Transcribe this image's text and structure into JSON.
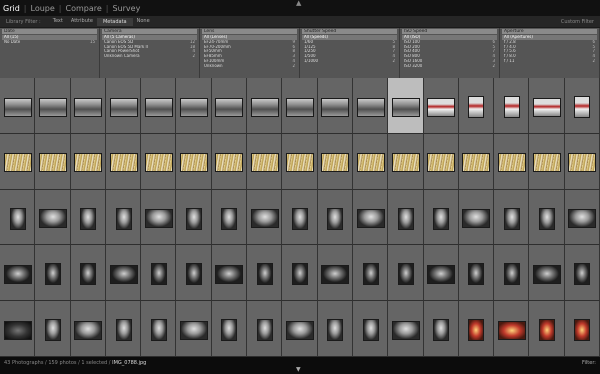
{
  "topbar": {
    "modes": [
      {
        "label": "Grid",
        "active": true
      },
      {
        "label": "Loupe",
        "active": false
      },
      {
        "label": "Compare",
        "active": false
      },
      {
        "label": "Survey",
        "active": false
      }
    ]
  },
  "library_filter": {
    "label": "Library Filter :",
    "items": [
      {
        "label": "Text",
        "active": false
      },
      {
        "label": "Attribute",
        "active": false
      },
      {
        "label": "Metadata",
        "active": true
      },
      {
        "label": "None",
        "active": false
      }
    ],
    "custom": "Custom Filter"
  },
  "filter_columns": [
    {
      "header": "Date",
      "rows": [
        {
          "label": "All (15)",
          "count": "",
          "sel": true
        },
        {
          "label": "No Date",
          "count": "15",
          "sel": false
        }
      ]
    },
    {
      "header": "Camera",
      "rows": [
        {
          "label": "All (5 Cameras)",
          "count": "",
          "sel": true
        },
        {
          "label": "Canon EOS 5D",
          "count": "12",
          "sel": false
        },
        {
          "label": "Canon EOS 5D Mark II",
          "count": "18",
          "sel": false
        },
        {
          "label": "Canon PowerShot",
          "count": "4",
          "sel": false
        },
        {
          "label": "Unknown Camera",
          "count": "2",
          "sel": false
        }
      ]
    },
    {
      "header": "Lens",
      "rows": [
        {
          "label": "All (Lenses)",
          "count": "",
          "sel": true
        },
        {
          "label": "EF24-70mm",
          "count": "9",
          "sel": false
        },
        {
          "label": "EF70-200mm",
          "count": "6",
          "sel": false
        },
        {
          "label": "EF50mm",
          "count": "8",
          "sel": false
        },
        {
          "label": "EF85mm",
          "count": "3",
          "sel": false
        },
        {
          "label": "EF100mm",
          "count": "4",
          "sel": false
        },
        {
          "label": "Unknown",
          "count": "2",
          "sel": false
        }
      ]
    },
    {
      "header": "Shutter Speed",
      "rows": [
        {
          "label": "All (Speeds)",
          "count": "",
          "sel": true
        },
        {
          "label": "1/60",
          "count": "5",
          "sel": false
        },
        {
          "label": "1/125",
          "count": "8",
          "sel": false
        },
        {
          "label": "1/250",
          "count": "7",
          "sel": false
        },
        {
          "label": "1/500",
          "count": "4",
          "sel": false
        },
        {
          "label": "1/1000",
          "count": "2",
          "sel": false
        }
      ]
    },
    {
      "header": "ISO Speed",
      "rows": [
        {
          "label": "All (ISO)",
          "count": "",
          "sel": true
        },
        {
          "label": "ISO 100",
          "count": "6",
          "sel": false
        },
        {
          "label": "ISO 200",
          "count": "5",
          "sel": false
        },
        {
          "label": "ISO 400",
          "count": "7",
          "sel": false
        },
        {
          "label": "ISO 800",
          "count": "4",
          "sel": false
        },
        {
          "label": "ISO 1600",
          "count": "3",
          "sel": false
        },
        {
          "label": "ISO 3200",
          "count": "2",
          "sel": false
        }
      ]
    },
    {
      "header": "Aperture",
      "rows": [
        {
          "label": "All (Apertures)",
          "count": "",
          "sel": true
        },
        {
          "label": "f / 2.8",
          "count": "6",
          "sel": false
        },
        {
          "label": "f / 4.0",
          "count": "5",
          "sel": false
        },
        {
          "label": "f / 5.6",
          "count": "7",
          "sel": false
        },
        {
          "label": "f / 8.0",
          "count": "4",
          "sel": false
        },
        {
          "label": "f / 11",
          "count": "2",
          "sel": false
        }
      ]
    }
  ],
  "grid": {
    "rows": [
      {
        "cells": [
          "office",
          "office",
          "office",
          "office",
          "office",
          "office",
          "office",
          "office",
          "office",
          "office",
          "office",
          "office",
          "people",
          "people",
          "people",
          "people",
          "people"
        ]
      },
      {
        "cells": [
          "corn",
          "corn",
          "corn",
          "corn",
          "corn",
          "corn",
          "corn",
          "corn",
          "corn",
          "corn",
          "corn",
          "corn",
          "corn",
          "corn",
          "corn",
          "corn",
          "corn"
        ]
      },
      {
        "cells": [
          "statue",
          "statue",
          "statue",
          "statue",
          "statue",
          "statue",
          "statue",
          "statue",
          "statue",
          "statue",
          "statue",
          "statue",
          "statue",
          "statue",
          "statue",
          "statue",
          "statue"
        ]
      },
      {
        "cells": [
          "statue2",
          "statue2",
          "statue2",
          "statue2",
          "statue2",
          "statue2",
          "statue2",
          "statue2",
          "statue2",
          "statue2",
          "statue2",
          "statue2",
          "statue2",
          "statue2",
          "statue2",
          "statue2",
          "statue2"
        ]
      },
      {
        "cells": [
          "dark",
          "statue",
          "statue",
          "statue",
          "statue",
          "statue",
          "statue",
          "statue",
          "statue",
          "statue",
          "statue",
          "statue",
          "statue",
          "red",
          "red",
          "red",
          "red"
        ]
      }
    ]
  },
  "status": {
    "info": "43 Photographs / 159 photos / 1 selected /",
    "filename": "IMG_0788.jpg",
    "right": "Filter:"
  }
}
